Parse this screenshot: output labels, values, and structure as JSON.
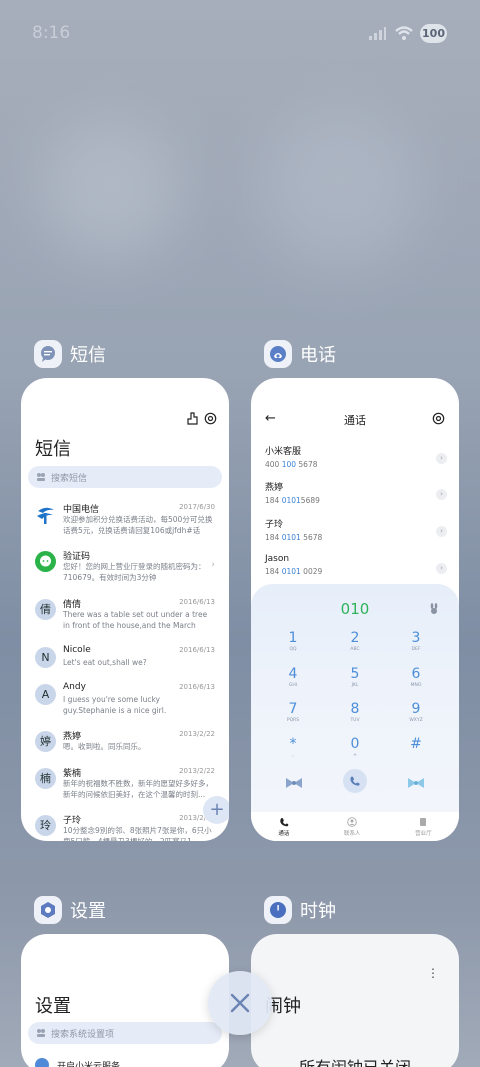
{
  "status_bar": {
    "time": "8:16",
    "battery": "100"
  },
  "apps": {
    "sms": {
      "name": "短信",
      "title": "短信",
      "search_placeholder": "搜索短信",
      "messages": [
        {
          "avatar": "",
          "name": "中国电信",
          "date": "2017/6/30",
          "text": "欢迎参加积分兑换话费活动，每500分可兑换话费5元，兑换话费请回复106或jfdh#话费..."
        },
        {
          "avatar": "",
          "name": "验证码",
          "date": "",
          "text": "您好！您的网上营业厅登录的随机密码为：710679。有效时间为3分钟"
        },
        {
          "avatar": "倩",
          "name": "倩倩",
          "date": "2016/6/13",
          "text": "There was a table set out under a tree in front of the house,and the March Hare an..."
        },
        {
          "avatar": "N",
          "name": "Nicole",
          "date": "2016/6/13",
          "text": "Let's eat out,shall we?"
        },
        {
          "avatar": "A",
          "name": "Andy",
          "date": "2016/6/13",
          "text": "I guess you're some lucky guy.Stephanie is a nice girl."
        },
        {
          "avatar": "婷",
          "name": "燕婷",
          "date": "2013/2/22",
          "text": "嗯。收到啦。同乐同乐。"
        },
        {
          "avatar": "楠",
          "name": "紫楠",
          "date": "2013/2/22",
          "text": "新年的祝福数不胜数，新年的愿望好多好多，新年的问候依旧美好，在这个温馨的时刻..."
        },
        {
          "avatar": "玲",
          "name": "子玲",
          "date": "2013/2/22",
          "text": "10分整念9別的邻、8张照片7张是你，6只小鹿5只熊，4棵最丑3棵好的，2匹赛马1..."
        }
      ]
    },
    "phone": {
      "name": "电话",
      "title": "通话",
      "calls": [
        {
          "name": "小米客服",
          "pre": "400 ",
          "hl": "100",
          "post": " 5678"
        },
        {
          "name": "燕婷",
          "pre": "184 ",
          "hl": "0101",
          "post": "5689"
        },
        {
          "name": "子玲",
          "pre": "184 ",
          "hl": "0101",
          "post": " 5678"
        },
        {
          "name": "Jason",
          "pre": "184 ",
          "hl": "0101",
          "post": " 0029"
        }
      ],
      "dialed": "010",
      "keys": [
        {
          "d": "1",
          "l": "QQ"
        },
        {
          "d": "2",
          "l": "ABC"
        },
        {
          "d": "3",
          "l": "DEF"
        },
        {
          "d": "4",
          "l": "GHI"
        },
        {
          "d": "5",
          "l": "JKL"
        },
        {
          "d": "6",
          "l": "MNO"
        },
        {
          "d": "7",
          "l": "PQRS"
        },
        {
          "d": "8",
          "l": "TUV"
        },
        {
          "d": "9",
          "l": "WXYZ"
        },
        {
          "d": "*",
          "l": ","
        },
        {
          "d": "0",
          "l": "+"
        },
        {
          "d": "#",
          "l": ""
        }
      ],
      "nav": {
        "calls": "通话",
        "contacts": "联系人",
        "business": "营业厅"
      }
    },
    "settings": {
      "name": "设置",
      "title": "设置",
      "search_placeholder": "搜索系统设置项",
      "first_item": "开启小米云服务"
    },
    "clock": {
      "name": "时钟",
      "title": "闹钟",
      "empty_text": "所有闹钟已关闭"
    }
  },
  "colors": {
    "accent_blue": "#4d8ed8",
    "dial_green": "#2fb35a",
    "sms_green": "#2bb34a",
    "telecom_blue": "#1f73c9"
  }
}
